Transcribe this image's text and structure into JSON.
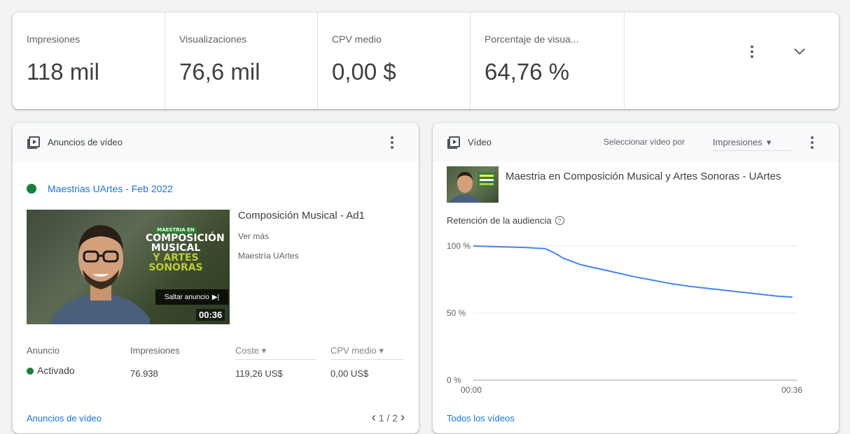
{
  "scorecard": {
    "metrics": [
      {
        "label": "Impresiones",
        "value": "118 mil"
      },
      {
        "label": "Visualizaciones",
        "value": "76,6 mil"
      },
      {
        "label": "CPV medio",
        "value": "0,00 $"
      },
      {
        "label": "Porcentaje de visua...",
        "value": "64,76 %"
      }
    ],
    "more_icon": "more-vert-icon",
    "expand_icon": "chevron-down-icon"
  },
  "video_ads": {
    "title": "Anuncios de vídeo",
    "campaign": "Maestrias UArtes - Feb 2022",
    "thumbnail": {
      "tag": "MAESTRIA EN",
      "line1": "COMPOSICIÓN",
      "line2": "MUSICAL",
      "line3": "Y ARTES",
      "line4": "SONORAS",
      "skip": "Saltar anuncio",
      "duration": "00:36"
    },
    "ad_headline": "Composición Musical - Ad1",
    "ad_cta": "Ver más",
    "ad_display": "Maestría UArtes",
    "table": {
      "headers": [
        "Anuncio",
        "Impresiones",
        "Coste",
        "CPV medio"
      ],
      "row": [
        "Activado",
        "76.938",
        "119,26 US$",
        "0,00 US$"
      ]
    },
    "footer_link": "Anuncios de vídeo",
    "pager": "1 / 2"
  },
  "video": {
    "title": "Vídeo",
    "select_label": "Seleccionar vídeo por",
    "select_value": "Impresiones",
    "video_title": "Maestria en Composición Musical y Artes Sonoras - UArtes",
    "retention_label": "Retención de la audiencia",
    "footer_link": "Todos los vídeos",
    "accent_color": "#4285f4"
  },
  "chart_data": {
    "type": "line",
    "title": "Retención de la audiencia",
    "x_ticks": [
      "00:00",
      "00:36"
    ],
    "y_ticks": [
      "100 %",
      "50 %",
      "0 %"
    ],
    "ylim": [
      0,
      100
    ],
    "xlim": [
      0,
      36
    ],
    "series": [
      {
        "x": [
          0,
          2,
          4,
          6,
          8,
          9,
          10,
          12,
          14,
          16,
          18,
          20,
          22,
          24,
          26,
          28,
          30,
          32,
          34,
          35.5
        ],
        "values": [
          100,
          99.6,
          99.2,
          98.8,
          98,
          95,
          91,
          86,
          83,
          80,
          77,
          74.5,
          72,
          70,
          68.5,
          67,
          65.5,
          64,
          62.5,
          62
        ]
      }
    ]
  }
}
